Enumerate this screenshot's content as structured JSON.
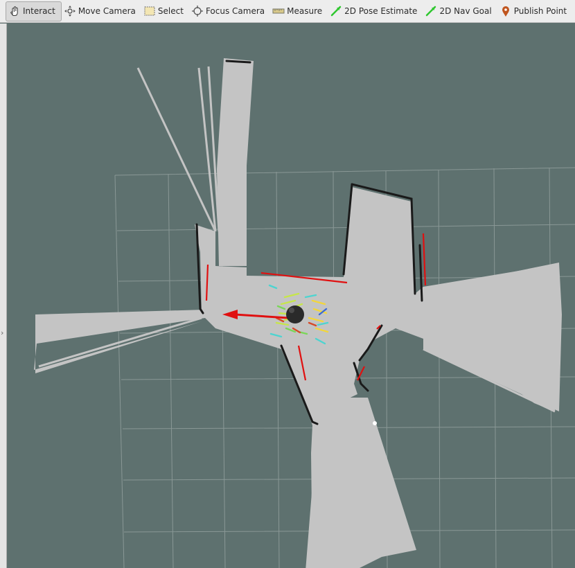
{
  "toolbar": {
    "tools": [
      {
        "label": "Interact",
        "icon": "hand-pointer-icon",
        "active": true
      },
      {
        "label": "Move Camera",
        "icon": "move-camera-icon",
        "active": false
      },
      {
        "label": "Select",
        "icon": "select-box-icon",
        "active": false
      },
      {
        "label": "Focus Camera",
        "icon": "focus-camera-icon",
        "active": false
      },
      {
        "label": "Measure",
        "icon": "ruler-icon",
        "active": false
      },
      {
        "label": "2D Pose Estimate",
        "icon": "green-arrow-icon",
        "active": false
      },
      {
        "label": "2D Nav Goal",
        "icon": "green-arrow-icon",
        "active": false
      },
      {
        "label": "Publish Point",
        "icon": "map-pin-icon",
        "active": false
      }
    ]
  },
  "side_handle": {
    "glyph": "›"
  },
  "colors": {
    "background": "#5e716f",
    "free_space": "#c4c4c4",
    "obstacle": "#1a1a1a",
    "laser": "#e01010",
    "grid": "#8a9896",
    "robot": "#2a2a2a",
    "nav_green": "#2fc72f",
    "pin": "#c0561f"
  }
}
